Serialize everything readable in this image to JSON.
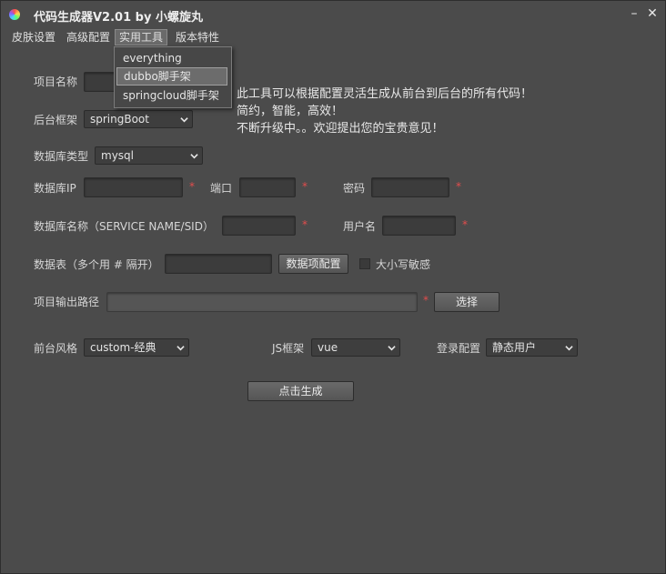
{
  "window": {
    "title": "代码生成器V2.01 by 小螺旋丸",
    "minimize": "–",
    "close": "✕"
  },
  "menubar": {
    "items": [
      "皮肤设置",
      "高级配置",
      "实用工具",
      "版本特性"
    ]
  },
  "dropdown": {
    "items": [
      "everything",
      "dubbo脚手架",
      "springcloud脚手架"
    ],
    "highlighted": "dubbo脚手架"
  },
  "info": {
    "line1": "此工具可以根据配置灵活生成从前台到后台的所有代码！",
    "line2": "简约，智能，高效！",
    "line3": "不断升级中。。欢迎提出您的宝贵意见！"
  },
  "form": {
    "project_name_label": "项目名称",
    "backend_framework_label": "后台框架",
    "backend_framework_value": "springBoot",
    "db_type_label": "数据库类型",
    "db_type_value": "mysql",
    "db_ip_label": "数据库IP",
    "port_label": "端口",
    "password_label": "密码",
    "db_name_label": "数据库名称（SERVICE NAME/SID）",
    "username_label": "用户名",
    "tables_label": "数据表（多个用 # 隔开）",
    "data_config_button": "数据项配置",
    "case_sensitive_label": "大小写敏感",
    "output_path_label": "项目输出路径",
    "choose_button": "选择",
    "frontend_style_label": "前台风格",
    "frontend_style_value": "custom-经典",
    "js_framework_label": "JS框架",
    "js_framework_value": "vue",
    "login_config_label": "登录配置",
    "login_config_value": "静态用户",
    "generate_button": "点击生成",
    "required_mark": "*"
  },
  "icons": {
    "app": "app-logo-icon",
    "chevron": "chevron-down-icon"
  },
  "colors": {
    "background": "#4b4b4b",
    "required": "#e24d4d"
  }
}
